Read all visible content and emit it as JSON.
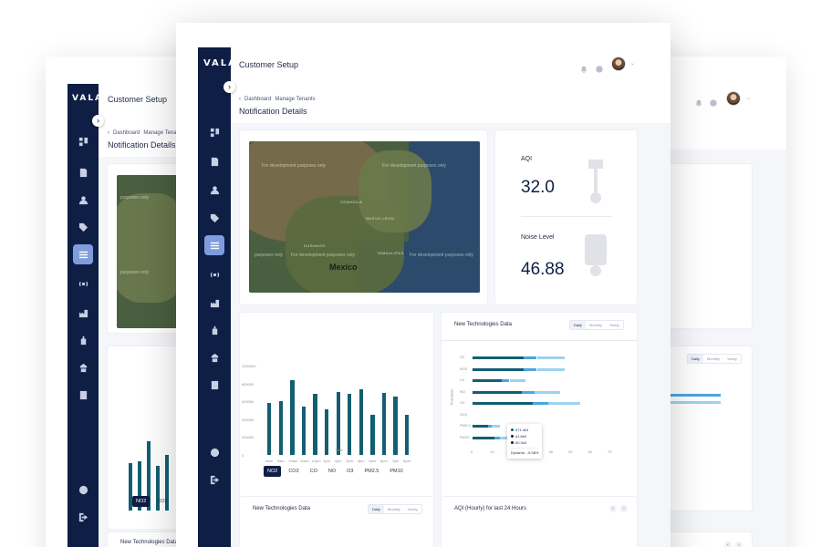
{
  "app": {
    "logo": "VALA",
    "title": "Customer Setup"
  },
  "breadcrumb": {
    "items": [
      "Dashboard",
      "Manage Tenants"
    ]
  },
  "page": {
    "title": "Notification Details"
  },
  "map": {
    "country": "Mexico",
    "watermark": "For development purposes only",
    "watermark_fragment": "purposes only",
    "states": [
      "NUEVO LEON",
      "DURANGO",
      "TAMAULIPAS",
      "COAHUILA"
    ]
  },
  "metrics": {
    "aqi_label": "AQI",
    "aqi_value": "32.0",
    "noise_label": "Noise Level",
    "noise_value": "46.88"
  },
  "bar_chart": {
    "y_ticks": [
      "1000000",
      "800000",
      "600000",
      "400000",
      "200000",
      "0"
    ],
    "x_ticks": [
      "8am",
      "9am",
      "10am",
      "11am",
      "12pm",
      "1pm",
      "2pm",
      "3pm",
      "4pm",
      "5pm",
      "6pm",
      "7pm",
      "8pm",
      "9pm"
    ],
    "x_label": "Time",
    "chips": [
      "NO2",
      "CO2",
      "CO",
      "NO",
      "O3",
      "PM2.5",
      "PM10"
    ],
    "back_chips": [
      "NO2",
      "CO2"
    ]
  },
  "tech_card": {
    "title": "New Technologies Data",
    "toggle": [
      "Daily",
      "Monthly",
      "Yearly"
    ],
    "y_axis_label": "Pollutants",
    "rows": [
      "O2",
      "NO2",
      "Co",
      "NO",
      "O3",
      "SO3",
      "PM2.5",
      "PM10"
    ],
    "x_ticks": [
      "0",
      "10",
      "20",
      "30",
      "40",
      "50",
      "60",
      "70"
    ],
    "tooltip": [
      "d71.4k3",
      "d1.8s9",
      "60.3s9"
    ],
    "tooltip_footer": [
      "Dynamic",
      "-5.08%"
    ]
  },
  "aqi_card": {
    "title": "AQI (Hourly) for last 24 Hours",
    "nav": [
      "‹",
      "›"
    ]
  },
  "chart_data": [
    {
      "type": "bar",
      "categories": [
        "8am",
        "9am",
        "10am",
        "11am",
        "12pm",
        "1pm",
        "2pm",
        "3pm",
        "4pm",
        "5pm",
        "6pm",
        "7pm",
        "8pm",
        "9pm"
      ],
      "values": [
        580000,
        600000,
        840000,
        540000,
        680000,
        510000,
        700000,
        680000,
        730000,
        450000,
        690000,
        650000,
        450000,
        0
      ],
      "xlabel": "Time",
      "ylim": [
        0,
        1000000
      ]
    },
    {
      "type": "bar",
      "orientation": "horizontal",
      "categories": [
        "O2",
        "NO2",
        "Co",
        "NO",
        "O3",
        "SO3",
        "PM2.5",
        "PM10"
      ],
      "series": [
        {
          "values": [
            47,
            47,
            27,
            45,
            55,
            0,
            14,
            20
          ]
        }
      ],
      "xlim": [
        0,
        70
      ],
      "ylabel": "Pollutants"
    }
  ],
  "colors": {
    "sidebar": "#0e1e45",
    "accent": "#7f9ddc",
    "bar": "#135e72",
    "hbar_mid": "#4aa6e0",
    "hbar_light": "#9fd1f1"
  }
}
